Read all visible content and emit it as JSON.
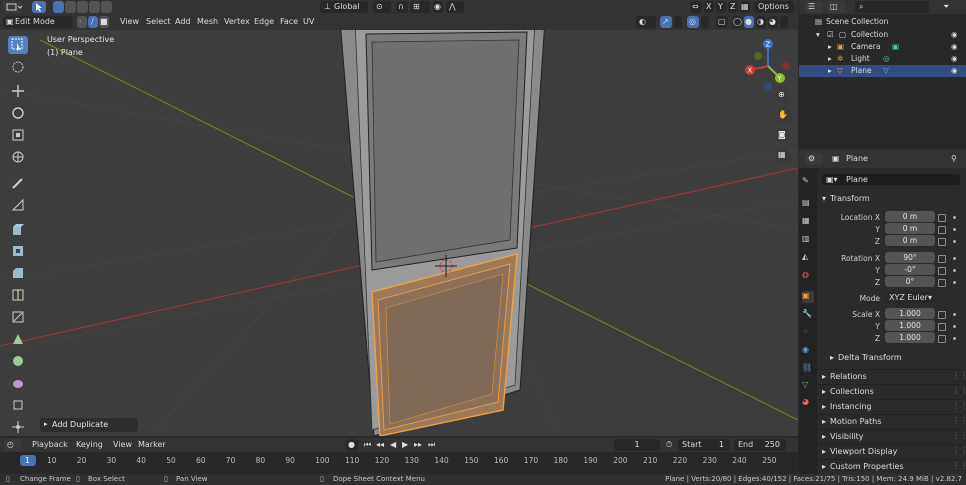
{
  "viewport_header": {
    "mode": "Edit Mode",
    "menus": [
      "View",
      "Select",
      "Add",
      "Mesh",
      "Vertex",
      "Edge",
      "Face",
      "UV"
    ],
    "orientation": "Global",
    "options": "Options",
    "axes": [
      "X",
      "Y",
      "Z"
    ]
  },
  "viewport": {
    "perspective": "User Perspective",
    "object": "(1) Plane",
    "last_operator": "Add Duplicate",
    "gizmo_axes": [
      "X",
      "Y",
      "Z"
    ]
  },
  "timeline": {
    "menus": [
      "Playback",
      "Keying",
      "View",
      "Marker"
    ],
    "current_frame": "1",
    "start_label": "Start",
    "start": "1",
    "end_label": "End",
    "end": "250",
    "ticks": [
      "1",
      "10",
      "20",
      "30",
      "40",
      "50",
      "60",
      "70",
      "80",
      "90",
      "100",
      "110",
      "120",
      "130",
      "140",
      "150",
      "160",
      "170",
      "180",
      "190",
      "200",
      "210",
      "220",
      "230",
      "240",
      "250"
    ]
  },
  "statusbar": {
    "left": [
      "Change Frame",
      "Box Select",
      "Pan View",
      "Dope Sheet Context Menu"
    ],
    "right": "Plane | Verts:20/80 | Edges:40/152 | Faces:21/75 | Tris:150 | Mem: 24.9 MiB | v2.82.7"
  },
  "outliner": {
    "root": "Scene Collection",
    "collection": "Collection",
    "items": [
      "Camera",
      "Light",
      "Plane"
    ]
  },
  "properties": {
    "object_name_header": "Plane",
    "object_name_field": "Plane",
    "transform_title": "Transform",
    "location_label": "Location X",
    "location": [
      "0 m",
      "0 m",
      "0 m"
    ],
    "rotation_label": "Rotation X",
    "rotation": [
      "90°",
      "-0°",
      "0°"
    ],
    "mode_label": "Mode",
    "mode_value": "XYZ Euler",
    "scale_label": "Scale X",
    "scale": [
      "1.000",
      "1.000",
      "1.000"
    ],
    "axis_y": "Y",
    "axis_z": "Z",
    "delta": "Delta Transform",
    "sections": [
      "Relations",
      "Collections",
      "Instancing",
      "Motion Paths",
      "Visibility",
      "Viewport Display",
      "Custom Properties"
    ]
  },
  "colors": {
    "accent": "#4772b3",
    "selection_orange": "#f0a040",
    "x_axis": "#c83c3c",
    "y_axis": "#8cbe28"
  }
}
